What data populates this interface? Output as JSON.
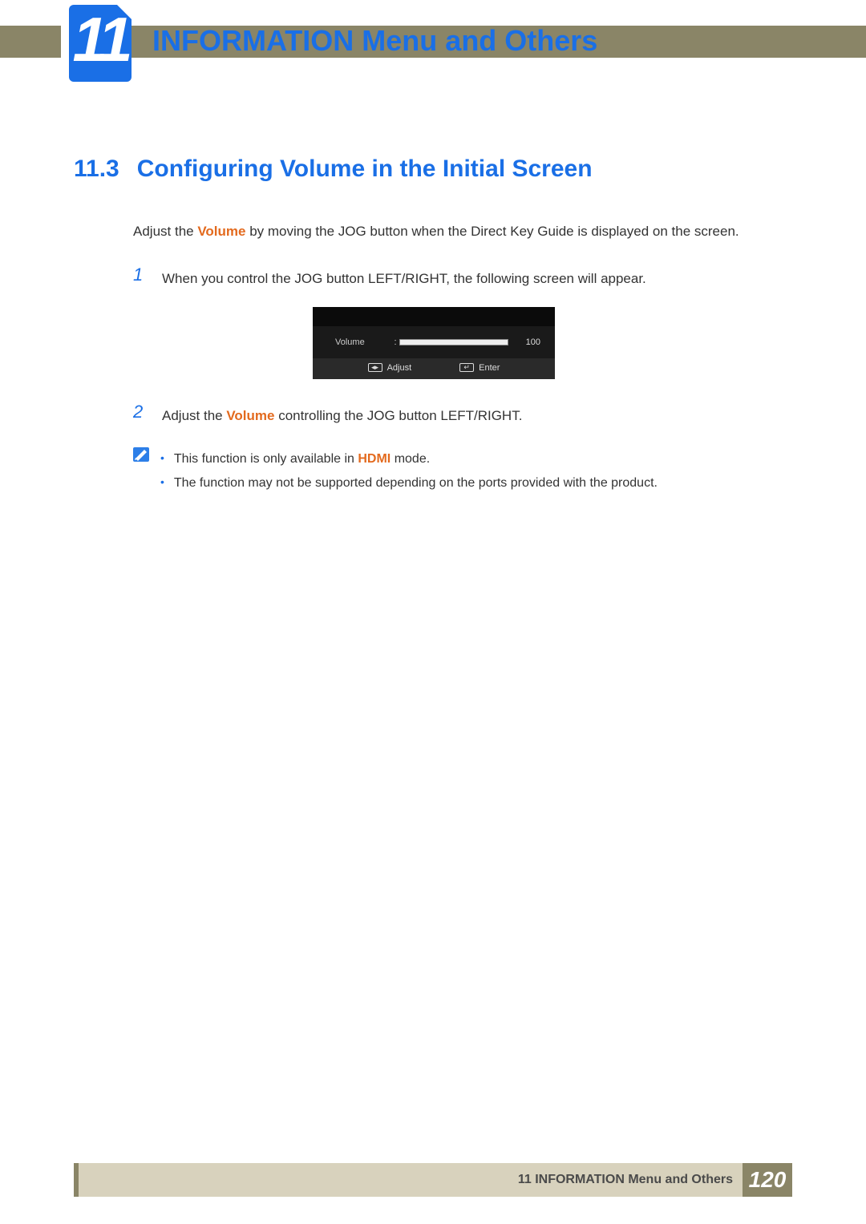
{
  "chapter": {
    "number": "11",
    "title": "INFORMATION Menu and Others"
  },
  "section": {
    "number": "11.3",
    "title": "Configuring Volume in the Initial Screen"
  },
  "intro": {
    "pre": "Adjust the ",
    "keyword": "Volume",
    "post": " by moving the JOG button when the Direct Key Guide is displayed on the screen."
  },
  "steps": {
    "s1": {
      "num": "1",
      "text": "When you control the JOG button LEFT/RIGHT, the following screen will appear."
    },
    "s2": {
      "num": "2",
      "pre": "Adjust the ",
      "keyword": "Volume",
      "post": " controlling the JOG button LEFT/RIGHT."
    }
  },
  "osd": {
    "label": "Volume",
    "value": "100",
    "adjust_label": "Adjust",
    "enter_label": "Enter",
    "adjust_glyph": "◂▸",
    "enter_glyph": "↵"
  },
  "note": {
    "b1": {
      "pre": "This function is only available in ",
      "keyword": "HDMI",
      "post": " mode."
    },
    "b2": {
      "text": "The function may not be supported depending on the ports provided with the product."
    }
  },
  "footer": {
    "label": "11 INFORMATION Menu and Others",
    "page": "120"
  }
}
